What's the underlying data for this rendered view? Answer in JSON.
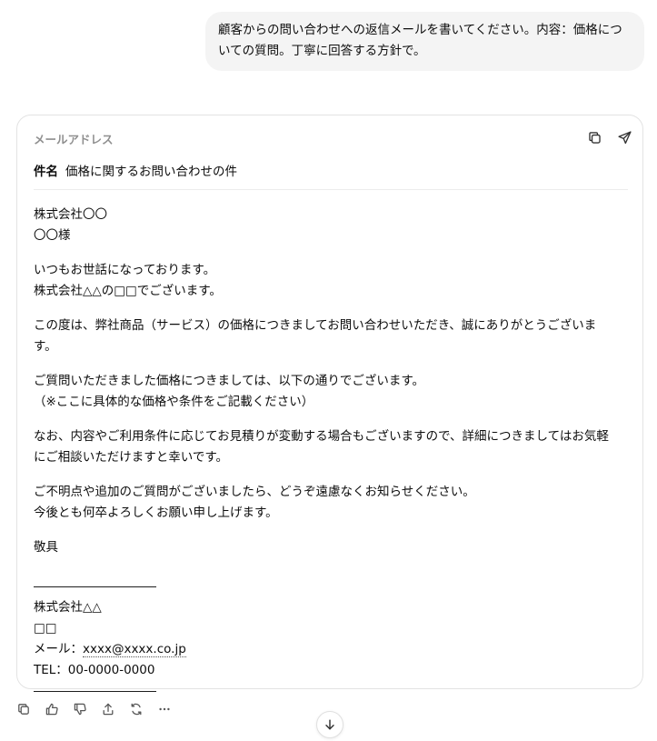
{
  "user_message": {
    "text": "顧客からの問い合わせへの返信メールを書いてください。内容：価格についての質問。丁寧に回答する方針で。"
  },
  "email_card": {
    "header_label": "メールアドレス",
    "subject_label": "件名",
    "subject_value": "価格に関するお問い合わせの件",
    "body": {
      "recipient_company": "株式会社〇〇",
      "recipient_name": "〇〇様",
      "greeting_1": "いつもお世話になっております。",
      "greeting_2": "株式会社△△の□□でございます。",
      "thanks": "この度は、弊社商品（サービス）の価格につきましてお問い合わせいただき、誠にありがとうございます。",
      "answer_1": "ご質問いただきました価格につきましては、以下の通りでございます。",
      "answer_2": "（※ここに具体的な価格や条件をご記載ください）",
      "note": "なお、内容やご利用条件に応じてお見積りが変動する場合もございますので、詳細につきましてはお気軽にご相談いただけますと幸いです。",
      "closing_1": "ご不明点や追加のご質問がございましたら、どうぞ遠慮なくお知らせください。",
      "closing_2": "今後とも何卒よろしくお願い申し上げます。",
      "sign_off": "敬具",
      "sig_line": "――――――――――",
      "sig_company": "株式会社△△",
      "sig_name": "□□",
      "sig_email_label": "メール：",
      "sig_email_value": "xxxx@xxxx.co.jp",
      "sig_tel": "TEL：00-0000-0000",
      "sig_line_end": "――――――――――"
    },
    "icons": {
      "copy": "copy-icon",
      "send": "send-icon"
    }
  },
  "footer_icons": [
    "copy-icon",
    "thumbs-up-icon",
    "thumbs-down-icon",
    "share-icon",
    "regenerate-icon",
    "more-icon"
  ],
  "scroll_icon": "arrow-down-icon"
}
